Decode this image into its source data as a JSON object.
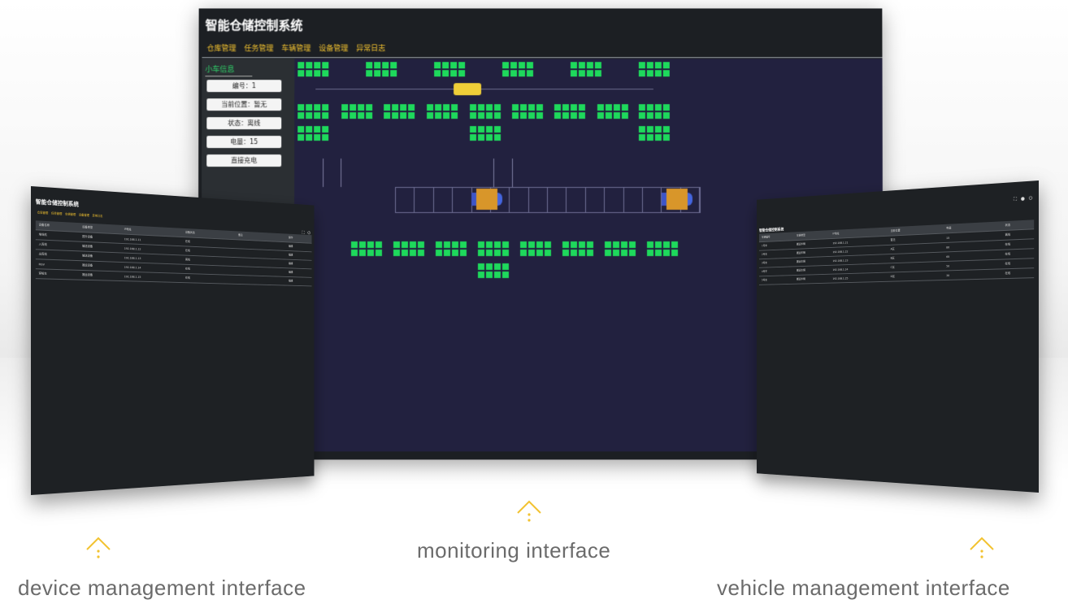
{
  "main_screen": {
    "title": "智能仓储控制系统",
    "menu": [
      "仓库管理",
      "任务管理",
      "车辆管理",
      "设备管理",
      "异常日志"
    ],
    "sidebar": {
      "title": "小车信息",
      "fields": [
        "编号：1",
        "当前位置：暂无",
        "状态：离线",
        "电量：15"
      ],
      "charge_button": "直接充电"
    }
  },
  "device_screen": {
    "title": "智能仓储控制系统",
    "menu": [
      "仓库管理",
      "任务管理",
      "车辆管理",
      "设备管理",
      "异常日志"
    ],
    "columns": [
      "设备名称",
      "设备类型",
      "IP地址",
      "设备状态",
      "备注",
      "操作"
    ],
    "rows": [
      [
        "堆垛机",
        "提升设备",
        "192.168.1.11",
        "在线",
        "",
        "编辑"
      ],
      [
        "入库线",
        "输送设备",
        "192.168.1.12",
        "在线",
        "",
        "编辑"
      ],
      [
        "出库线",
        "输送设备",
        "192.168.1.13",
        "离线",
        "",
        "编辑"
      ],
      [
        "RGV",
        "搬运设备",
        "192.168.1.14",
        "在线",
        "",
        "编辑"
      ],
      [
        "穿梭车",
        "搬运设备",
        "192.168.1.15",
        "在线",
        "",
        "编辑"
      ]
    ]
  },
  "vehicle_screen": {
    "title": "智能仓储控制系统",
    "menu": [
      "仓库管理",
      "任务管理",
      "车辆管理",
      "设备管理",
      "异常日志"
    ],
    "columns": [
      "车辆编号",
      "车辆类型",
      "IP地址",
      "当前位置",
      "电量",
      "状态"
    ],
    "rows": [
      [
        "1号车",
        "搬运车辆",
        "192.168.1.21",
        "暂无",
        "15",
        "离线"
      ],
      [
        "2号车",
        "搬运车辆",
        "192.168.1.22",
        "A区",
        "80",
        "在线"
      ],
      [
        "3号车",
        "搬运车辆",
        "192.168.1.23",
        "B区",
        "65",
        "在线"
      ],
      [
        "4号车",
        "搬运车辆",
        "192.168.1.24",
        "C区",
        "50",
        "在线"
      ],
      [
        "5号车",
        "搬运车辆",
        "192.168.1.25",
        "D区",
        "30",
        "在线"
      ]
    ],
    "icons": [
      "expand-icon",
      "user-icon",
      "power-icon"
    ]
  },
  "captions": {
    "device": "device management interface",
    "monitoring": "monitoring interface",
    "vehicle": "vehicle management interface"
  },
  "colors": {
    "accent": "#f2c230",
    "rack_green": "#1ed95c",
    "map_bg": "#22213f",
    "panel_bg": "#1c1f23",
    "agv_body": "#d8962a",
    "agv_blue": "#3d55c8",
    "shuttle": "#f0cf38"
  }
}
